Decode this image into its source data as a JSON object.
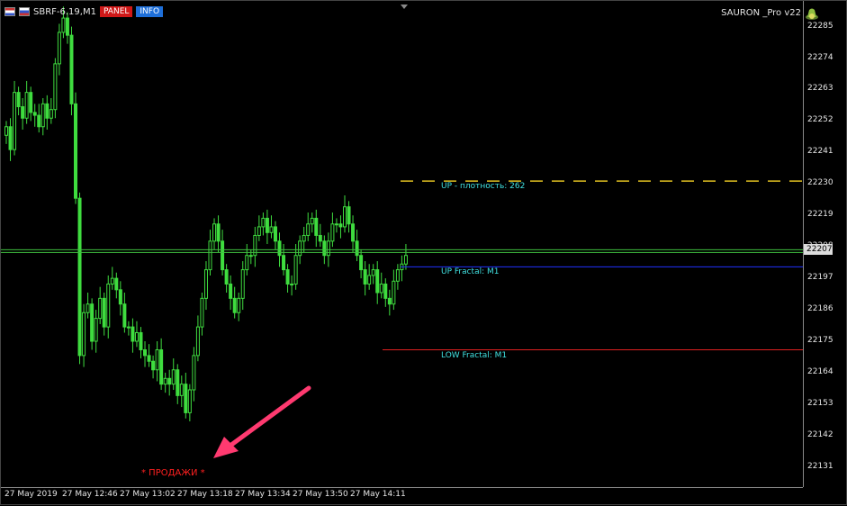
{
  "window": {
    "symbol": "SBRF-6.19,M1",
    "panel_button": "PANEL",
    "info_button": "INFO",
    "expert_name": "SAURON _Pro v22"
  },
  "price_axis": {
    "ticks": [
      "22285",
      "22274",
      "22263",
      "22252",
      "22241",
      "22230",
      "22219",
      "22208",
      "22197",
      "22186",
      "22175",
      "22164",
      "22153",
      "22142",
      "22131"
    ],
    "current_price": "22207"
  },
  "time_axis": {
    "ticks": [
      "27 May 2019",
      "27 May 12:46",
      "27 May 13:02",
      "27 May 13:18",
      "27 May 13:34",
      "27 May 13:50",
      "27 May 14:11"
    ]
  },
  "levels": {
    "up_density": {
      "label": "UP - плотность:  262",
      "price": 22231,
      "color": "#e0c020"
    },
    "up_fractal": {
      "label": "UP Fractal:  M1",
      "price": 22201,
      "color": "#2030ff"
    },
    "low_fractal": {
      "label": "LOW Fractal:  M1",
      "price": 22172,
      "color": "#e02020"
    },
    "current_line_color": "#40c040"
  },
  "annotation": {
    "sell_label": "* ПРОДАЖИ *",
    "arrow_color": "#ff3a70"
  },
  "colors": {
    "candle": "#3fdc3f",
    "background": "#000000"
  },
  "chart_data": {
    "type": "candlestick",
    "x_start": "27 May 2019",
    "ylim": [
      22124,
      22294
    ],
    "close": [
      22250,
      22242,
      22262,
      22257,
      22253,
      22262,
      22255,
      22254,
      22250,
      22258,
      22253,
      22256,
      22272,
      22283,
      22288,
      22282,
      22258,
      22225,
      22170,
      22185,
      22188,
      22175,
      22183,
      22190,
      22180,
      22195,
      22197,
      22193,
      22188,
      22180,
      22180,
      22175,
      22178,
      22172,
      22170,
      22168,
      22165,
      22172,
      22160,
      22162,
      22160,
      22165,
      22156,
      22160,
      22150,
      22158,
      22170,
      22180,
      22190,
      22200,
      22210,
      22216,
      22210,
      22200,
      22195,
      22190,
      22185,
      22190,
      22200,
      22205,
      22205,
      22212,
      22215,
      22218,
      22213,
      22215,
      22210,
      22205,
      22200,
      22195,
      22195,
      22205,
      22210,
      22212,
      22216,
      22218,
      22212,
      22210,
      22205,
      22210,
      22216,
      22216,
      22215,
      22222,
      22216,
      22210,
      22205,
      22200,
      22195,
      22198,
      22200,
      22192,
      22195,
      22190,
      22188,
      22196,
      22200,
      22202,
      22205
    ]
  }
}
